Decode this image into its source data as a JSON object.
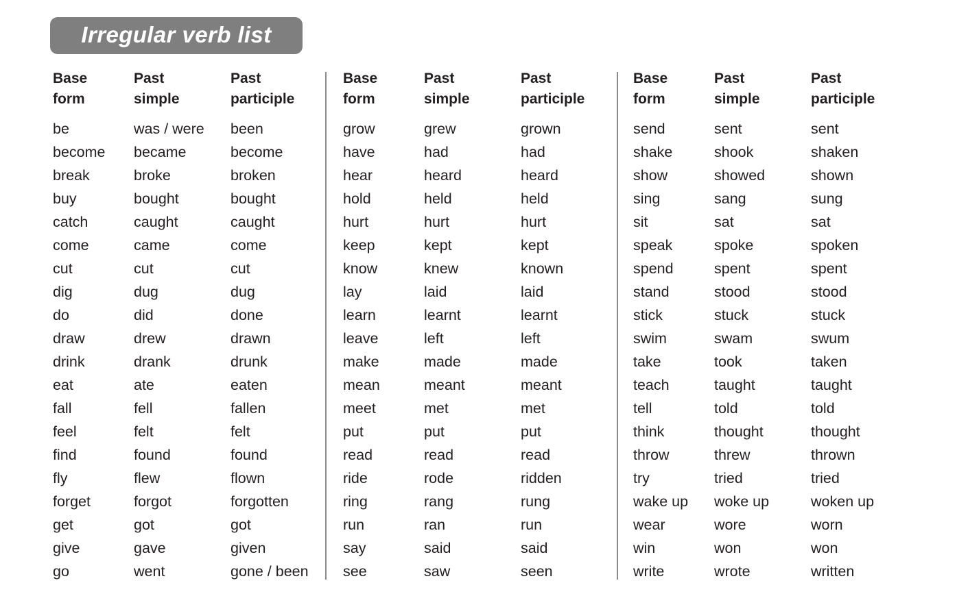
{
  "title": "Irregular verb list",
  "columns": [
    "Base\nform",
    "Past\nsimple",
    "Past\nparticiple"
  ],
  "groups": [
    {
      "headers": [
        "Base\nform",
        "Past\nsimple",
        "Past\nparticiple"
      ],
      "rows": [
        [
          "be",
          "was / were",
          "been"
        ],
        [
          "become",
          "became",
          "become"
        ],
        [
          "break",
          "broke",
          "broken"
        ],
        [
          "buy",
          "bought",
          "bought"
        ],
        [
          "catch",
          "caught",
          "caught"
        ],
        [
          "come",
          "came",
          "come"
        ],
        [
          "cut",
          "cut",
          "cut"
        ],
        [
          "dig",
          "dug",
          "dug"
        ],
        [
          "do",
          "did",
          "done"
        ],
        [
          "draw",
          "drew",
          "drawn"
        ],
        [
          "drink",
          "drank",
          "drunk"
        ],
        [
          "eat",
          "ate",
          "eaten"
        ],
        [
          "fall",
          "fell",
          "fallen"
        ],
        [
          "feel",
          "felt",
          "felt"
        ],
        [
          "find",
          "found",
          "found"
        ],
        [
          "fly",
          "flew",
          "flown"
        ],
        [
          "forget",
          "forgot",
          "forgotten"
        ],
        [
          "get",
          "got",
          "got"
        ],
        [
          "give",
          "gave",
          "given"
        ],
        [
          "go",
          "went",
          "gone / been"
        ]
      ]
    },
    {
      "headers": [
        "Base\nform",
        "Past\nsimple",
        "Past\nparticiple"
      ],
      "rows": [
        [
          "grow",
          "grew",
          "grown"
        ],
        [
          "have",
          "had",
          "had"
        ],
        [
          "hear",
          "heard",
          "heard"
        ],
        [
          "hold",
          "held",
          "held"
        ],
        [
          "hurt",
          "hurt",
          "hurt"
        ],
        [
          "keep",
          "kept",
          "kept"
        ],
        [
          "know",
          "knew",
          "known"
        ],
        [
          "lay",
          "laid",
          "laid"
        ],
        [
          "learn",
          "learnt",
          "learnt"
        ],
        [
          "leave",
          "left",
          "left"
        ],
        [
          "make",
          "made",
          "made"
        ],
        [
          "mean",
          "meant",
          "meant"
        ],
        [
          "meet",
          "met",
          "met"
        ],
        [
          "put",
          "put",
          "put"
        ],
        [
          "read",
          "read",
          "read"
        ],
        [
          "ride",
          "rode",
          "ridden"
        ],
        [
          "ring",
          "rang",
          "rung"
        ],
        [
          "run",
          "ran",
          "run"
        ],
        [
          "say",
          "said",
          "said"
        ],
        [
          "see",
          "saw",
          "seen"
        ]
      ]
    },
    {
      "headers": [
        "Base\nform",
        "Past\nsimple",
        "Past\nparticiple"
      ],
      "rows": [
        [
          "send",
          "sent",
          "sent"
        ],
        [
          "shake",
          "shook",
          "shaken"
        ],
        [
          "show",
          "showed",
          "shown"
        ],
        [
          "sing",
          "sang",
          "sung"
        ],
        [
          "sit",
          "sat",
          "sat"
        ],
        [
          "speak",
          "spoke",
          "spoken"
        ],
        [
          "spend",
          "spent",
          "spent"
        ],
        [
          "stand",
          "stood",
          "stood"
        ],
        [
          "stick",
          "stuck",
          "stuck"
        ],
        [
          "swim",
          "swam",
          "swum"
        ],
        [
          "take",
          "took",
          "taken"
        ],
        [
          "teach",
          "taught",
          "taught"
        ],
        [
          "tell",
          "told",
          "told"
        ],
        [
          "think",
          "thought",
          "thought"
        ],
        [
          "throw",
          "threw",
          "thrown"
        ],
        [
          "try",
          "tried",
          "tried"
        ],
        [
          "wake up",
          "woke up",
          "woken up"
        ],
        [
          "wear",
          "wore",
          "worn"
        ],
        [
          "win",
          "won",
          "won"
        ],
        [
          "write",
          "wrote",
          "written"
        ]
      ]
    }
  ],
  "colors": {
    "title_background": "#7f7f7f",
    "title_text": "#ffffff",
    "body_text": "#231f20",
    "separator": "#8c8c8c",
    "page_background": "#ffffff"
  }
}
